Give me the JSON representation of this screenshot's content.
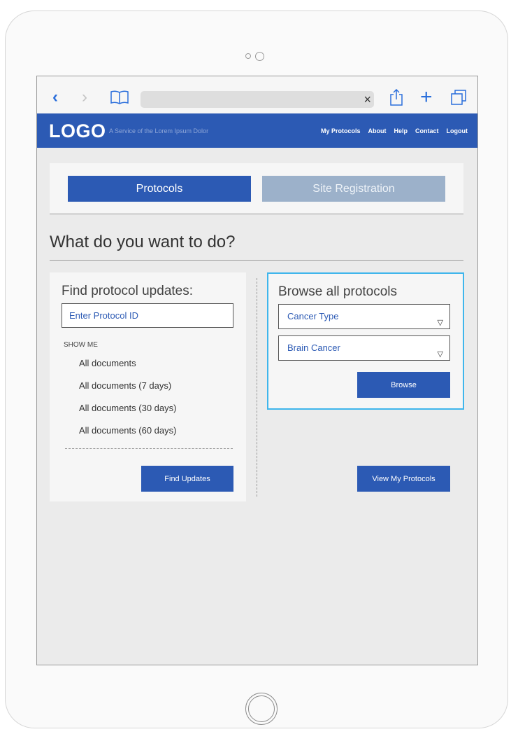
{
  "browser": {
    "back_icon": "‹",
    "forward_icon": "›",
    "bookmarks_icon": "book-icon",
    "clear_icon": "×",
    "share_icon": "share-icon",
    "new_tab_icon": "+",
    "tabs_icon": "tabs-icon"
  },
  "header": {
    "logo": "LOGO",
    "tagline": "A Service of the Lorem Ipsum Dolor",
    "nav": [
      "My Protocols",
      "About",
      "Help",
      "Contact",
      "Logout"
    ]
  },
  "tabs": [
    {
      "label": "Protocols",
      "active": true
    },
    {
      "label": "Site Registration",
      "active": false
    }
  ],
  "main": {
    "heading": "What do you want to do?"
  },
  "find_updates": {
    "title": "Find protocol updates:",
    "protocol_id_placeholder": "Enter Protocol ID",
    "show_me_label": "SHOW ME",
    "options": [
      "All documents",
      "All documents (7 days)",
      "All documents (30 days)",
      "All documents (60 days)"
    ],
    "button_label": "Find Updates"
  },
  "browse": {
    "title": "Browse all protocols",
    "cancer_type_select": "Cancer Type",
    "subtype_select": "Brain Cancer",
    "button_label": "Browse",
    "caret": "▽"
  },
  "my_protocols": {
    "button_label": "View My Protocols"
  },
  "colors": {
    "brand_blue": "#2c5ab4",
    "inactive_tab": "#9cb1ca",
    "focus_outline": "#3fb6ec"
  }
}
